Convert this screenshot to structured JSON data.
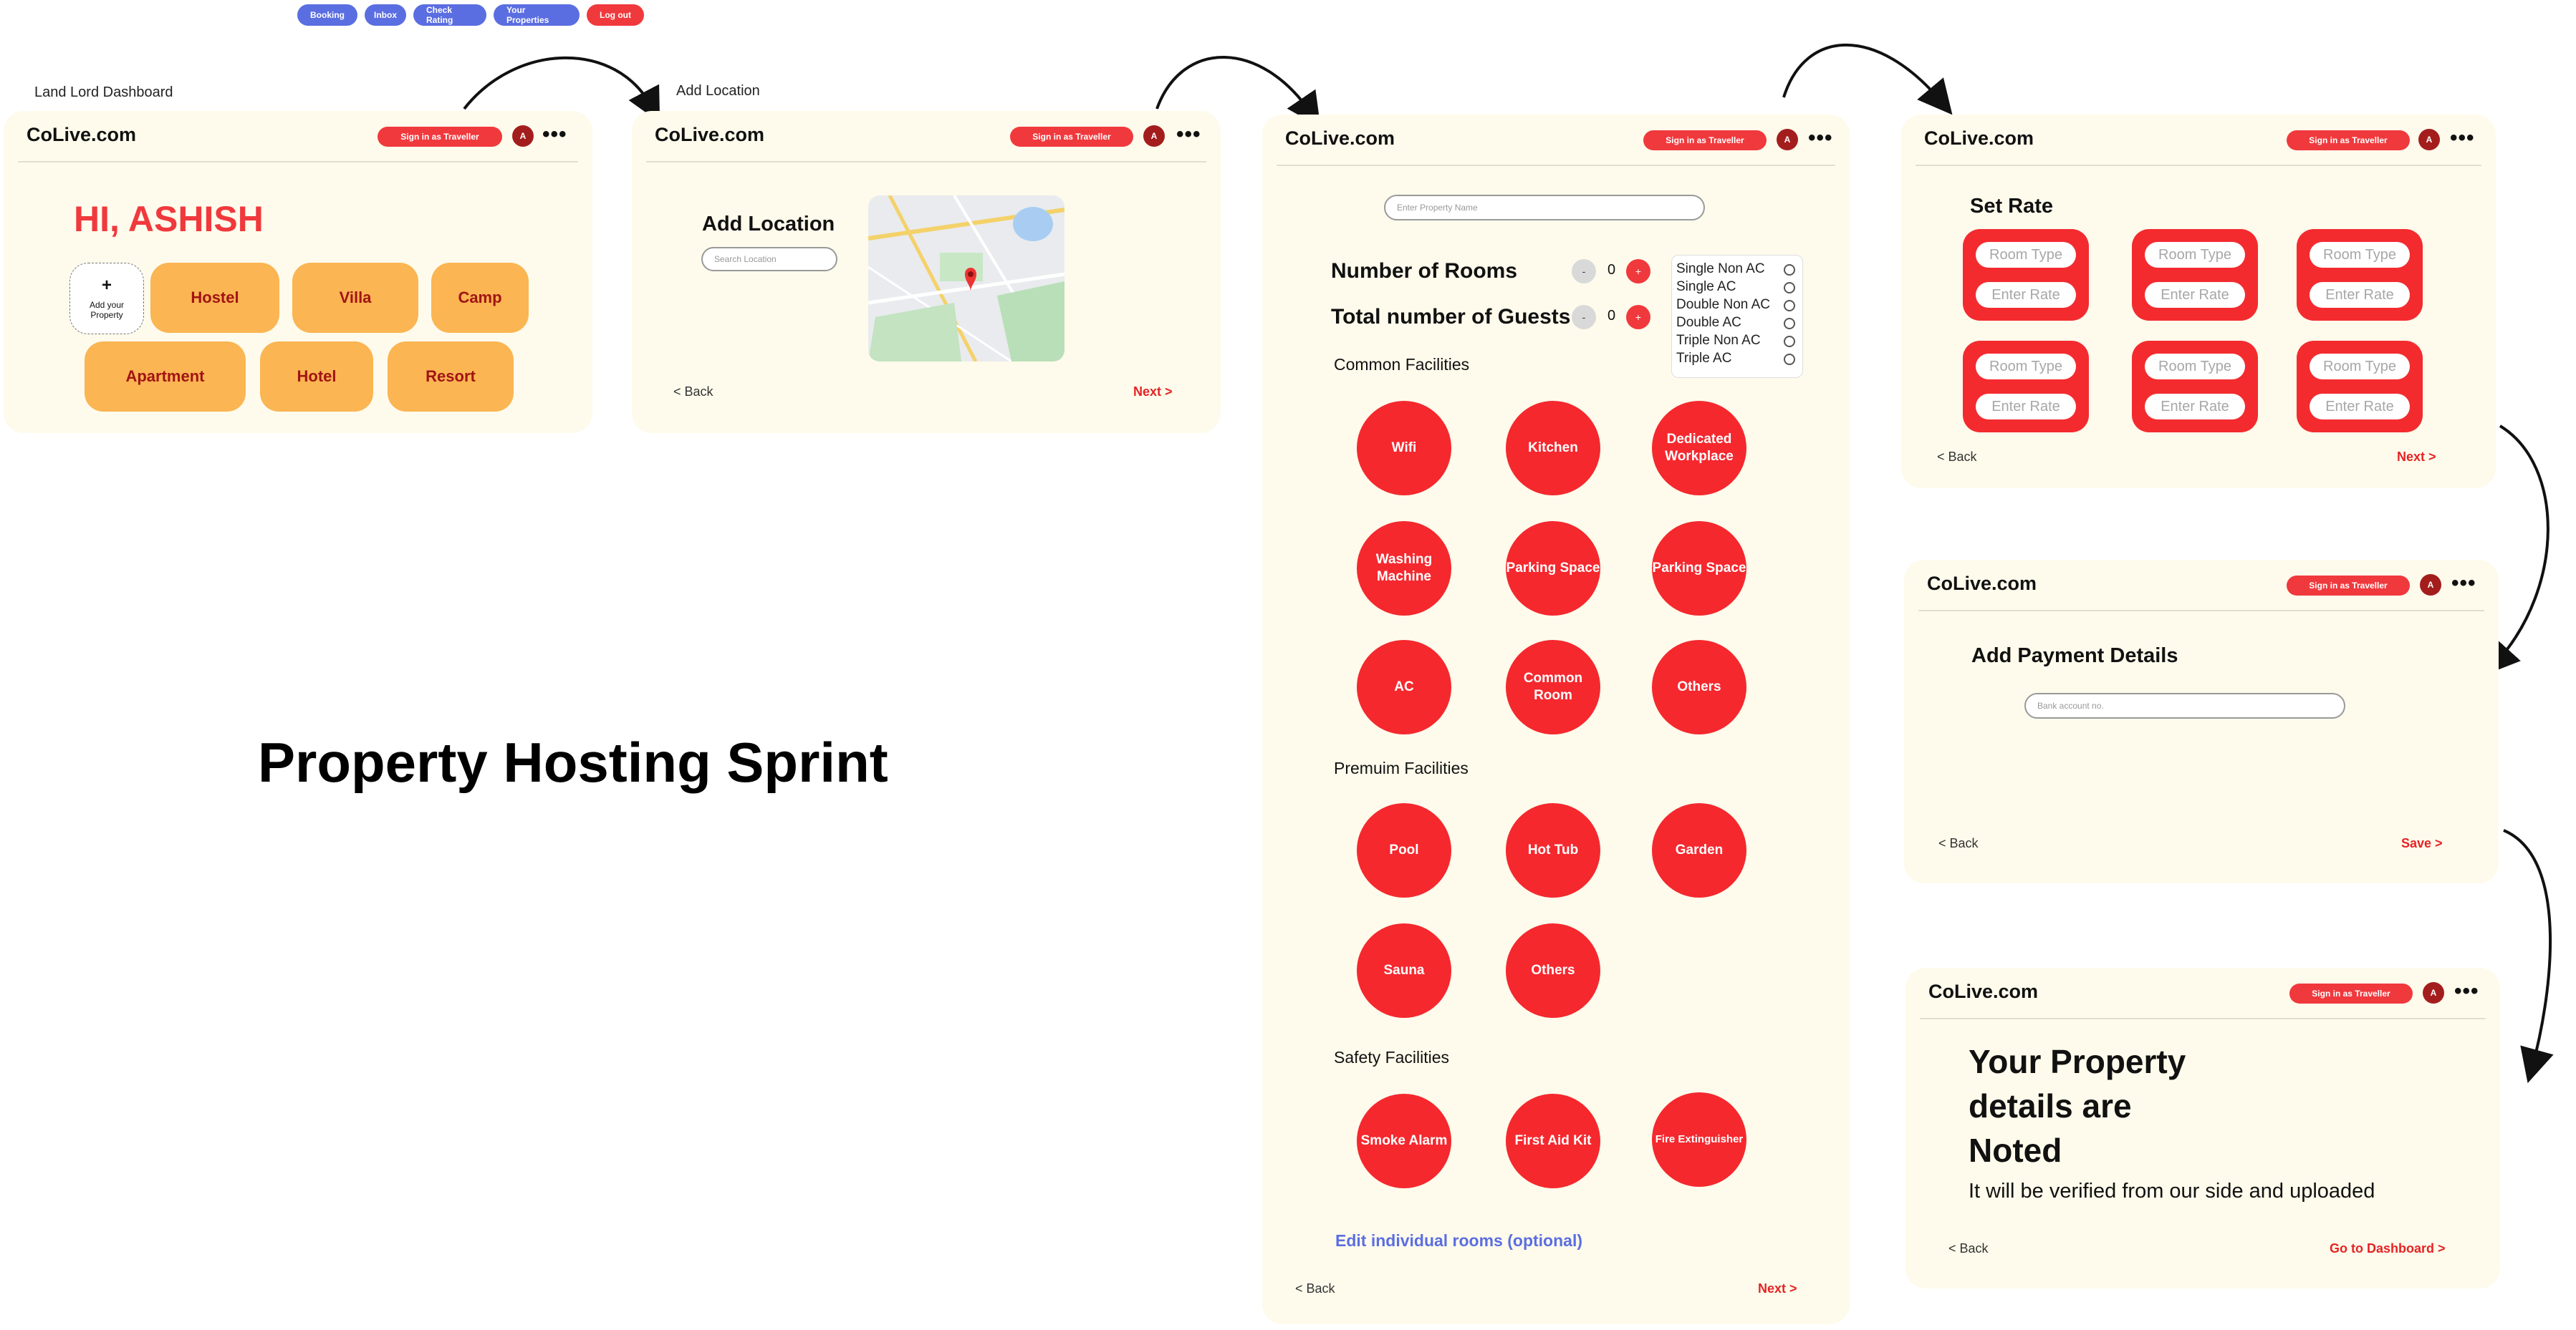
{
  "top_nav": [
    "Booking",
    "Inbox",
    "Check Rating",
    "Your Properties",
    "Log out"
  ],
  "labels": {
    "dashboard": "Land Lord Dashboard",
    "add_location": "Add Location",
    "sprint_title": "Property Hosting Sprint"
  },
  "header": {
    "logo": "CoLive.com",
    "sign_in": "Sign in as Traveller",
    "avatar": "A",
    "more": "•••"
  },
  "dashboard": {
    "greeting": "HI, ASHISH",
    "add_property_plus": "+",
    "add_property_label_1": "Add your",
    "add_property_label_2": "Property",
    "property_types": [
      "Hostel",
      "Villa",
      "Camp",
      "Apartment",
      "Hotel",
      "Resort"
    ]
  },
  "location": {
    "title": "Add Location",
    "search_placeholder": "Search Location",
    "back": "<  Back",
    "next": "Next  >"
  },
  "property_form": {
    "name_placeholder": "Enter Property Name",
    "rooms_label": "Number of Rooms",
    "guests_label": "Total number of Guests",
    "minus": "-",
    "plus": "+",
    "rooms_value": "0",
    "guests_value": "0",
    "room_options": [
      "Single Non AC",
      "Single AC",
      "Double Non AC",
      "Double AC",
      "Triple Non AC",
      "Triple AC"
    ],
    "common_title": "Common Facilities",
    "common": [
      "Wifi",
      "Kitchen",
      "Dedicated Workplace",
      "Washing Machine",
      "Parking Space",
      "Parking Space",
      "AC",
      "Common Room",
      "Others"
    ],
    "premium_title": "Premuim Facilities",
    "premium": [
      "Pool",
      "Hot Tub",
      "Garden",
      "Sauna",
      "Others"
    ],
    "safety_title": "Safety Facilities",
    "safety": [
      "Smoke Alarm",
      "First Aid Kit",
      "Fire Extinguisher"
    ],
    "edit_rooms": "Edit individual rooms (optional)",
    "back": "<  Back",
    "next": "Next  >"
  },
  "rate": {
    "title": "Set Rate",
    "room_type": "Room Type",
    "enter_rate": "Enter Rate",
    "back": "<  Back",
    "next": "Next  >"
  },
  "payment": {
    "title": "Add Payment Details",
    "bank_placeholder": "Bank account no.",
    "back": "<  Back",
    "save": "Save  >"
  },
  "confirm": {
    "line1": "Your Property",
    "line2": "details are",
    "line3": "Noted",
    "sub": "It will be verified from our side and uploaded",
    "back": "<  Back",
    "dashboard": "Go to Dashboard  >"
  },
  "colors": {
    "panel_bg": "#fefbec",
    "accent_red": "#f0393d",
    "property_orange": "#fbb553",
    "nav_blue": "#5b6ee1"
  }
}
